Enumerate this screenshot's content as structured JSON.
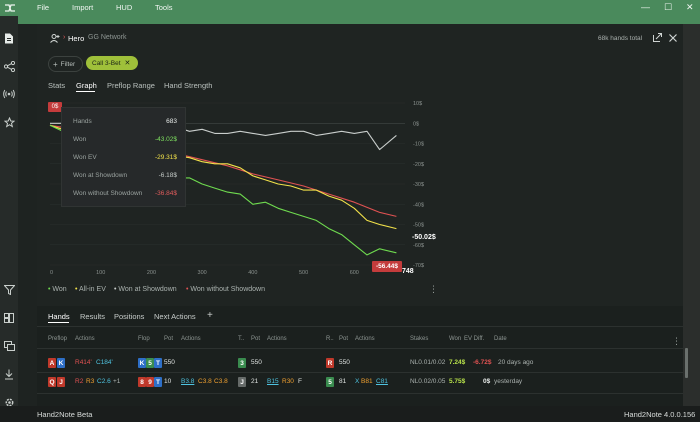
{
  "menu": {
    "file": "File",
    "import": "Import",
    "hud": "HUD",
    "tools": "Tools"
  },
  "window_controls": {
    "minimize": "—",
    "maximize": "☐",
    "close": "✕"
  },
  "header": {
    "player": "Hero",
    "site": "GG Network",
    "hands_total": "68k hands total"
  },
  "filter": {
    "filter_label": "Filter",
    "active_filter": "Call 3-Bet"
  },
  "graph_tabs": [
    "Stats",
    "Graph",
    "Preflop Range",
    "Hand Strength"
  ],
  "tooltip": {
    "badge": "0$",
    "rows": [
      {
        "label": "Hands",
        "value": "683",
        "color": "#e8ecea"
      },
      {
        "label": "Won",
        "value": "-43.02$",
        "color": "#7ee05f"
      },
      {
        "label": "Won EV",
        "value": "-29.31$",
        "color": "#f0e04a"
      },
      {
        "label": "Won at Showdown",
        "value": "-6.18$",
        "color": "#c5cbc8"
      },
      {
        "label": "Won without Showdown",
        "value": "-36.84$",
        "color": "#e05c5c"
      }
    ]
  },
  "chart_data": {
    "type": "line",
    "xlabel": "",
    "ylabel": "",
    "x_ticks": [
      0,
      100,
      200,
      300,
      400,
      500,
      600
    ],
    "xlim": [
      0,
      700
    ],
    "y_ticks": [
      "10$",
      "0$",
      "-10$",
      "-20$",
      "-30$",
      "-40$",
      "-50$",
      "-60$",
      "-70$"
    ],
    "ylim": [
      -70,
      10
    ],
    "series": [
      {
        "name": "Won",
        "color": "#6fdc4f",
        "values": [
          [
            0,
            -1
          ],
          [
            25,
            -4
          ],
          [
            50,
            -6
          ],
          [
            75,
            -9
          ],
          [
            100,
            -12
          ],
          [
            125,
            -14
          ],
          [
            150,
            -16
          ],
          [
            175,
            -19
          ],
          [
            200,
            -22
          ],
          [
            225,
            -24
          ],
          [
            250,
            -27
          ],
          [
            275,
            -27
          ],
          [
            300,
            -30
          ],
          [
            325,
            -32
          ],
          [
            350,
            -34
          ],
          [
            375,
            -35
          ],
          [
            400,
            -40
          ],
          [
            425,
            -39
          ],
          [
            450,
            -42
          ],
          [
            475,
            -44
          ],
          [
            500,
            -46
          ],
          [
            525,
            -48
          ],
          [
            550,
            -52
          ],
          [
            575,
            -55
          ],
          [
            600,
            -60
          ],
          [
            625,
            -65
          ],
          [
            650,
            -62
          ],
          [
            683,
            -64
          ]
        ]
      },
      {
        "name": "All-in EV",
        "color": "#f2e24a",
        "values": [
          [
            0,
            -1
          ],
          [
            25,
            -3
          ],
          [
            50,
            -5
          ],
          [
            75,
            -7
          ],
          [
            100,
            -8
          ],
          [
            125,
            -9
          ],
          [
            150,
            -10
          ],
          [
            175,
            -12
          ],
          [
            200,
            -14
          ],
          [
            225,
            -15
          ],
          [
            250,
            -16
          ],
          [
            275,
            -17
          ],
          [
            300,
            -19
          ],
          [
            325,
            -20
          ],
          [
            350,
            -20
          ],
          [
            375,
            -22
          ],
          [
            400,
            -26
          ],
          [
            425,
            -28
          ],
          [
            450,
            -30
          ],
          [
            475,
            -31
          ],
          [
            500,
            -33
          ],
          [
            525,
            -33
          ],
          [
            550,
            -36
          ],
          [
            575,
            -38
          ],
          [
            600,
            -42
          ],
          [
            625,
            -48
          ],
          [
            650,
            -50
          ],
          [
            683,
            -52
          ]
        ]
      },
      {
        "name": "Won at Showdown",
        "color": "#c9cecc",
        "values": [
          [
            0,
            0
          ],
          [
            25,
            0
          ],
          [
            50,
            -1
          ],
          [
            75,
            -1
          ],
          [
            100,
            -2
          ],
          [
            125,
            -1
          ],
          [
            150,
            -2
          ],
          [
            175,
            -2
          ],
          [
            200,
            -1
          ],
          [
            225,
            -1
          ],
          [
            250,
            -2
          ],
          [
            275,
            -4
          ],
          [
            300,
            -3
          ],
          [
            325,
            -5
          ],
          [
            350,
            -5
          ],
          [
            375,
            -4
          ],
          [
            400,
            -5
          ],
          [
            425,
            -6
          ],
          [
            450,
            -5
          ],
          [
            475,
            -4
          ],
          [
            500,
            -4
          ],
          [
            525,
            -6
          ],
          [
            550,
            -5
          ],
          [
            575,
            -4
          ],
          [
            600,
            -5
          ],
          [
            625,
            -4
          ],
          [
            650,
            -13
          ],
          [
            683,
            -6
          ]
        ]
      },
      {
        "name": "Won without Showdown",
        "color": "#e05252",
        "values": [
          [
            0,
            -1
          ],
          [
            50,
            -3
          ],
          [
            100,
            -6
          ],
          [
            150,
            -9
          ],
          [
            200,
            -12
          ],
          [
            250,
            -15
          ],
          [
            300,
            -18
          ],
          [
            350,
            -21
          ],
          [
            400,
            -25
          ],
          [
            450,
            -28
          ],
          [
            500,
            -31
          ],
          [
            550,
            -35
          ],
          [
            600,
            -39
          ],
          [
            650,
            -44
          ],
          [
            683,
            -46
          ]
        ]
      }
    ],
    "end_labels": [
      {
        "text": "-50.02$",
        "color": "#ffffff"
      },
      {
        "text": "-56.44$",
        "color": "#ffffff"
      },
      {
        "text": "748",
        "color": "#ffffff"
      }
    ],
    "legend": "bottom-left"
  },
  "hand_tabs": [
    "Hands",
    "Results",
    "Positions",
    "Next Actions"
  ],
  "columns": [
    "Preflop",
    "Actions",
    "Flop",
    "Pot",
    "Actions",
    "T..",
    "Pot",
    "Actions",
    "R..",
    "Pot",
    "Actions",
    "Stakes",
    "Won",
    "EV Diff.",
    "Date"
  ],
  "rows": [
    {
      "hole": [
        "A",
        "K"
      ],
      "hole_colors": [
        "#c0392b",
        "#2e6fc7"
      ],
      "pf_actions": "R414'",
      "pf_actions2": "C184'",
      "flop": [
        "K",
        "5",
        "T"
      ],
      "flop_colors": [
        "#2e6fc7",
        "#3a8c4f",
        "#2e6fc7"
      ],
      "flop_pot": "550",
      "turn": "3",
      "turn_color": "#3a8c4f",
      "turn_pot": "550",
      "river": "R",
      "river_color": "#c0392b",
      "river_pot": "550",
      "stakes": "NL0.01/0.02",
      "won": "7.24$",
      "ev_diff": "-6.72$",
      "date": "20 days ago"
    },
    {
      "hole": [
        "Q",
        "J"
      ],
      "hole_colors": [
        "#c0392b",
        "#c0392b"
      ],
      "pf_actions": "R2",
      "pf_actions2": "R3",
      "pf_actions3": "C2.6",
      "pf_actions4": "+1",
      "flop": [
        "8",
        "9",
        "T"
      ],
      "flop_colors": [
        "#c0392b",
        "#c0392b",
        "#2e6fc7"
      ],
      "flop_pot": "10",
      "flop_actions": "B3.8",
      "flop_actions2": "C3.8",
      "flop_actions3": "C3.8",
      "turn": "J",
      "turn_color": "#666b69",
      "turn_pot": "21",
      "turn_actions": "B15",
      "turn_actions2": "R30",
      "turn_actions3": "F",
      "river": "5",
      "river_color": "#3a8c4f",
      "river_pot": "81",
      "river_actions": "X",
      "river_actions2": "B81",
      "river_actions3": "C81",
      "stakes": "NL0.02/0.05",
      "won": "5.75$",
      "ev_diff": "0$",
      "date": "yesterday"
    }
  ],
  "status": {
    "left": "Hand2Note Beta",
    "right": "Hand2Note 4.0.0.156"
  },
  "colors": {
    "accent": "#4a8a5c",
    "filter_pill": "#9fc03a",
    "won": "#6fdc4f",
    "ev": "#f2e24a",
    "sd": "#c9cecc",
    "nsd": "#e05252"
  }
}
